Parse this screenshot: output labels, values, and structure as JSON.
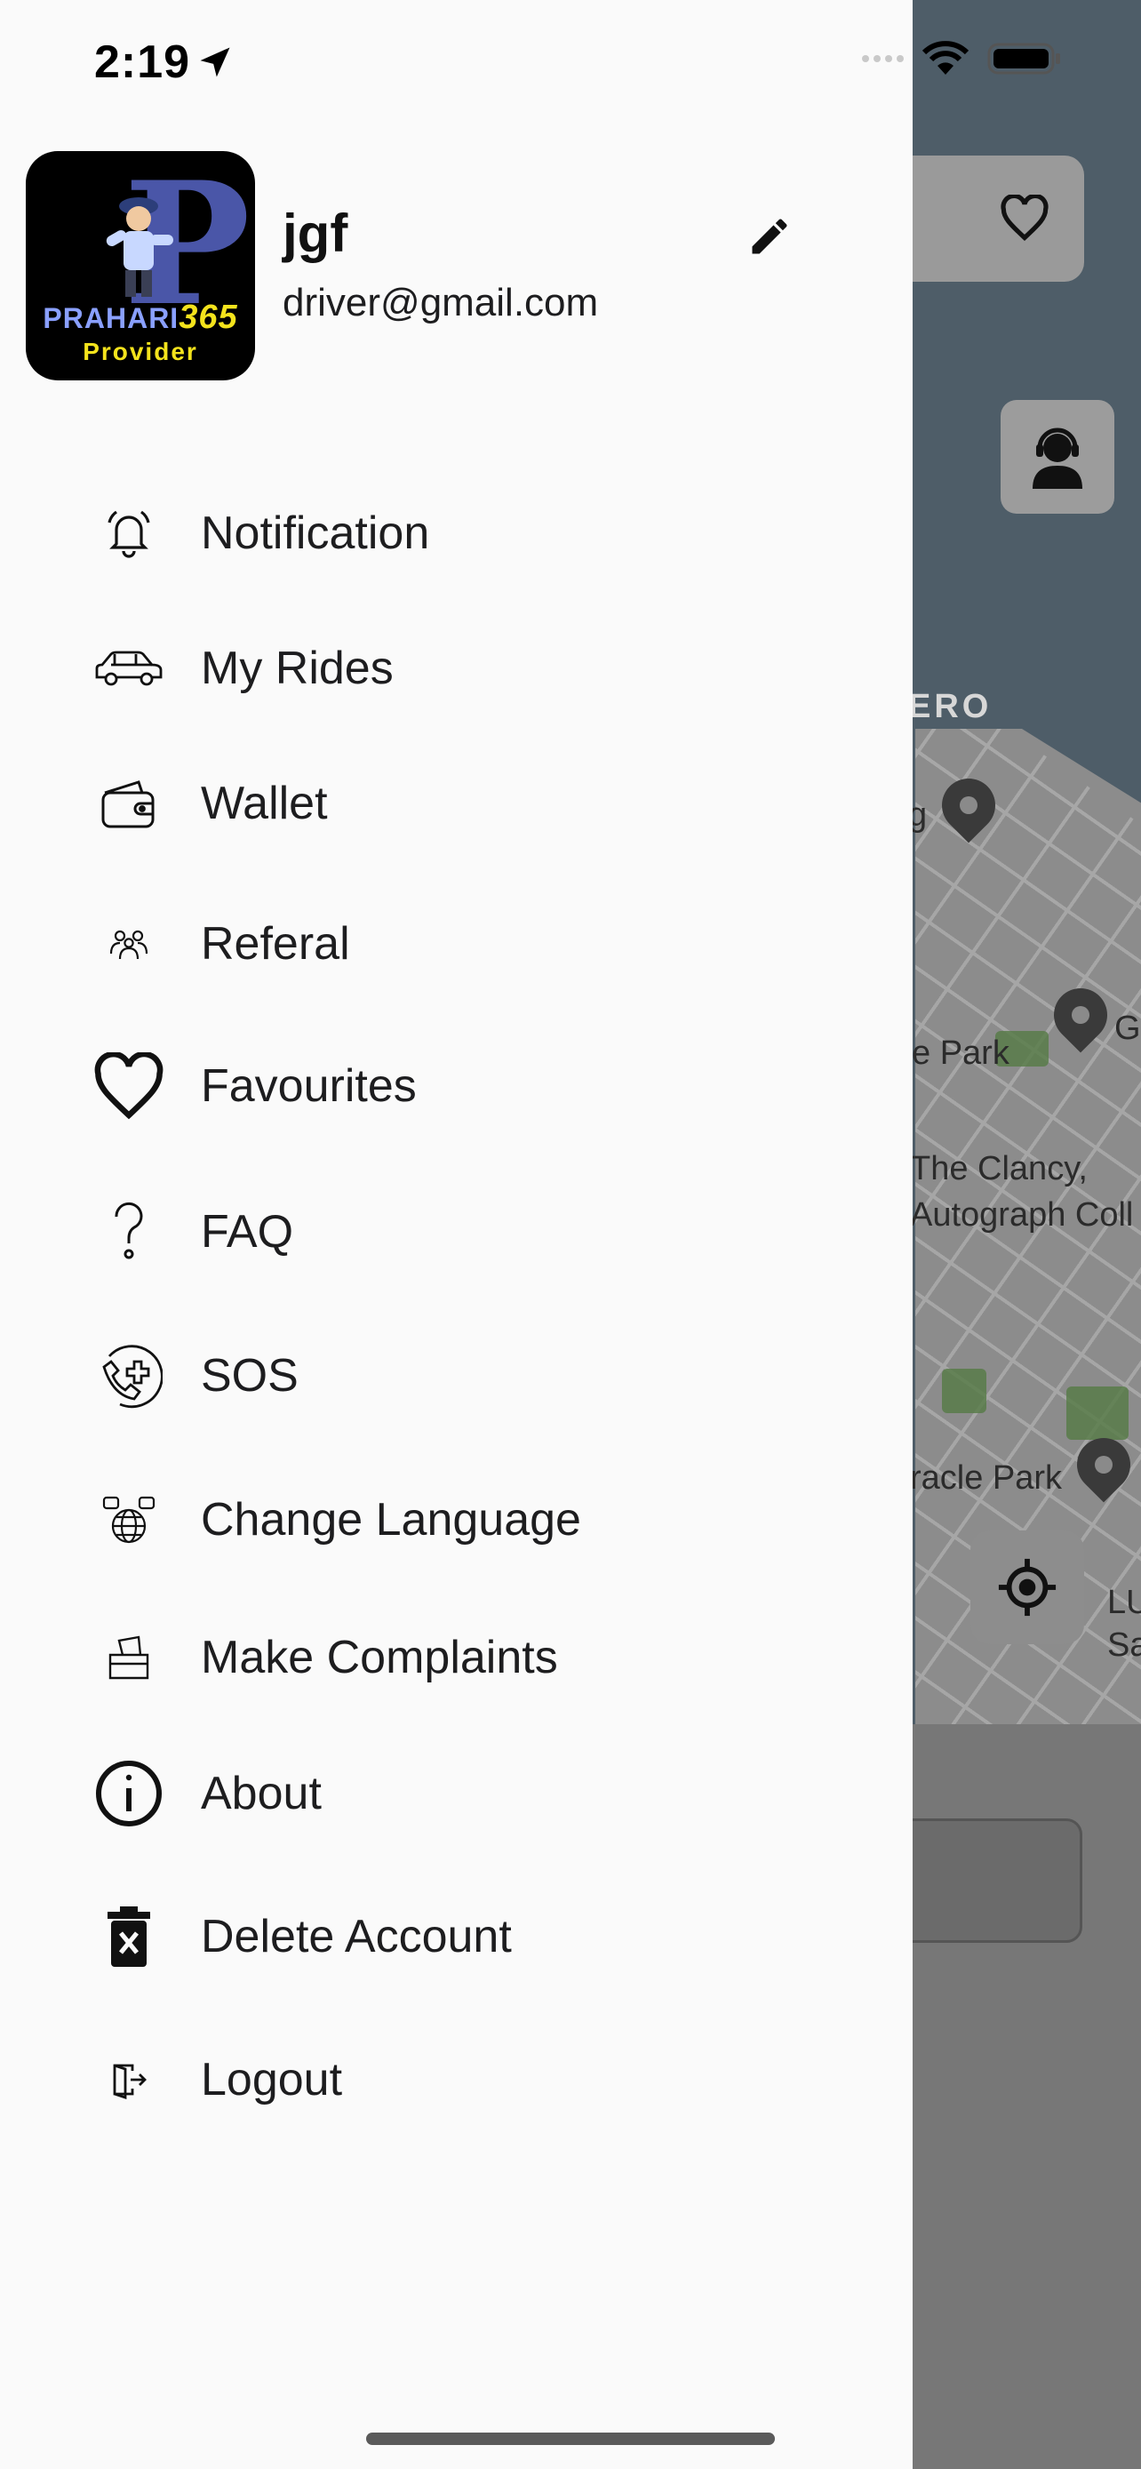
{
  "status_bar": {
    "time": "2:19"
  },
  "profile": {
    "name": "jgf",
    "email": "driver@gmail.com",
    "logo": {
      "brand_text": "PRAHARI",
      "brand_number": "365",
      "subtitle": "Provider"
    }
  },
  "menu": {
    "items": [
      {
        "label": "Notification",
        "icon": "bell-icon"
      },
      {
        "label": "My Rides",
        "icon": "car-icon"
      },
      {
        "label": "Wallet",
        "icon": "wallet-icon"
      },
      {
        "label": "Referal",
        "icon": "people-icon"
      },
      {
        "label": "Favourites",
        "icon": "heart-icon"
      },
      {
        "label": "FAQ",
        "icon": "question-icon"
      },
      {
        "label": "SOS",
        "icon": "phone-medical-icon"
      },
      {
        "label": "Change Language",
        "icon": "globe-language-icon"
      },
      {
        "label": "Make Complaints",
        "icon": "complaint-box-icon"
      },
      {
        "label": "About",
        "icon": "info-icon"
      },
      {
        "label": "Delete Account",
        "icon": "trash-icon"
      },
      {
        "label": "Logout",
        "icon": "logout-icon"
      }
    ]
  },
  "map": {
    "labels": [
      "ERO",
      "g",
      "e Park",
      "The Clancy,",
      "Autograph Coll",
      "racle Park",
      "LU",
      "Sa",
      "G"
    ]
  }
}
